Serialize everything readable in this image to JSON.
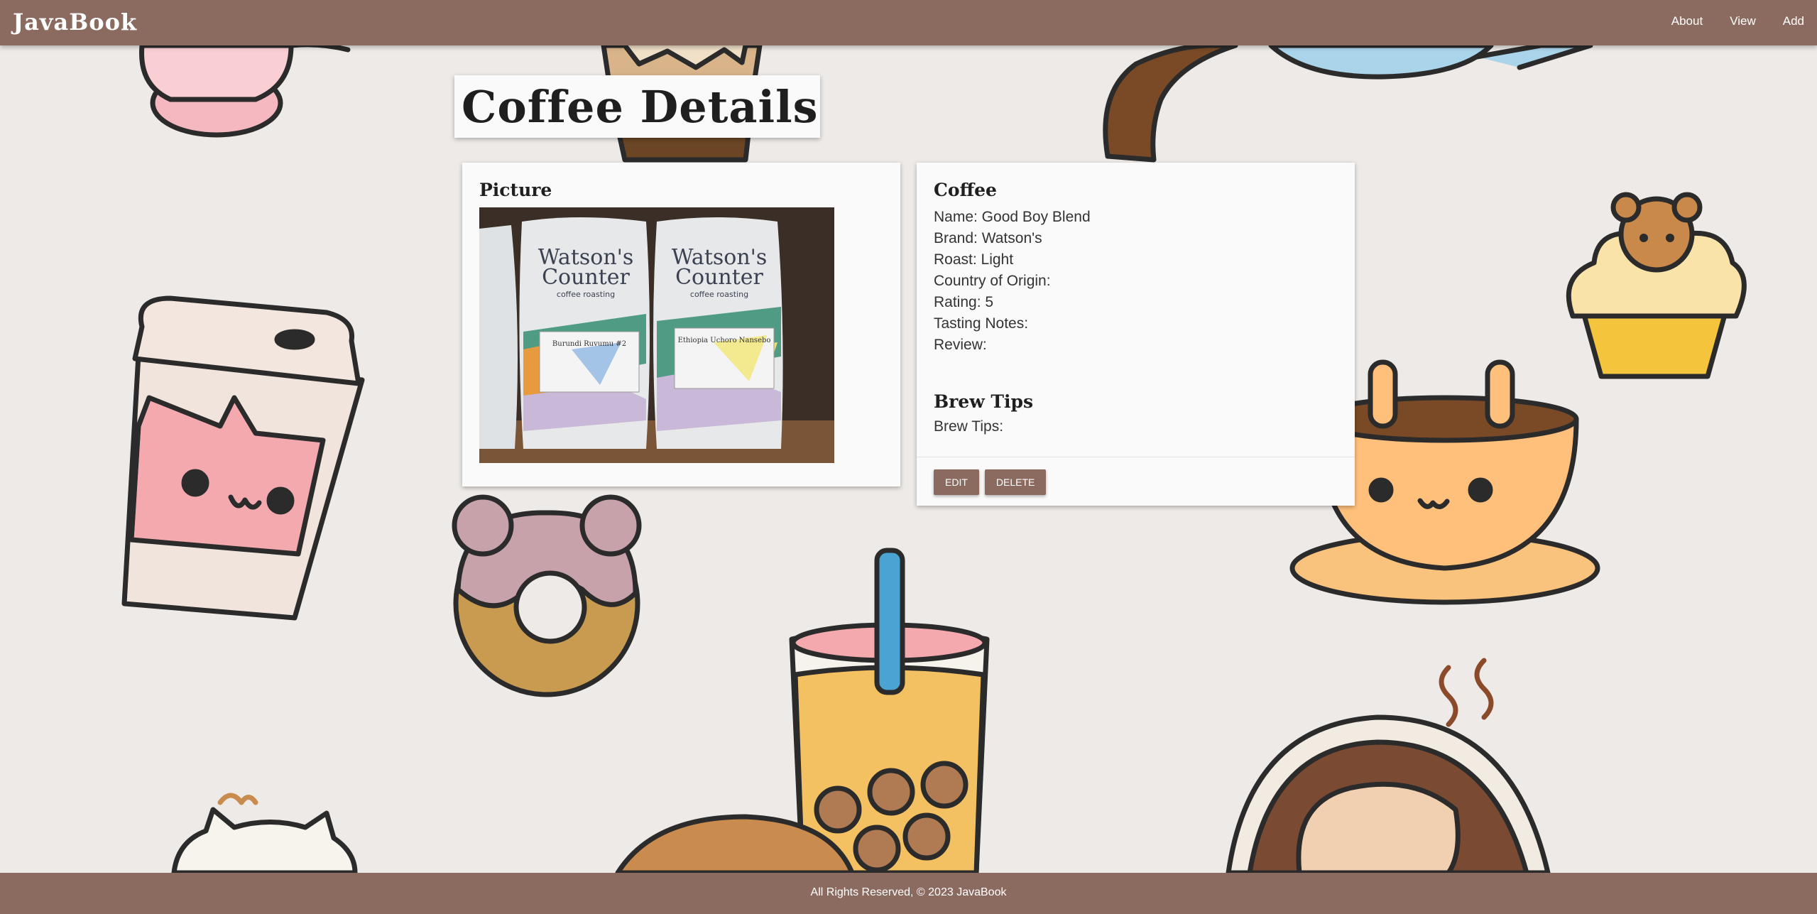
{
  "navbar": {
    "brand": "JavaBook",
    "links": [
      "About",
      "View",
      "Add"
    ]
  },
  "page": {
    "title": "Coffee Details"
  },
  "picture_card": {
    "title": "Picture",
    "photo": {
      "bag_brand_line1": "Watson's",
      "bag_brand_line2": "Counter",
      "bag_tagline": "coffee roasting",
      "label_left": "Burundi Ruvumu #2",
      "label_right": "Ethiopia Uchoro Nansebo"
    }
  },
  "coffee_card": {
    "title": "Coffee",
    "details": [
      "Name: Good Boy Blend",
      "Brand: Watson's",
      "Roast: Light",
      "Country of Origin:",
      "Rating: 5",
      "Tasting Notes:",
      "Review:"
    ],
    "brew_title": "Brew Tips",
    "brew_tips": "Brew Tips:",
    "buttons": {
      "edit": "EDIT",
      "delete": "DELETE"
    }
  },
  "footer": {
    "text": "All Rights Reserved, © 2023 JavaBook"
  },
  "colors": {
    "nav_brown": "#8b6b60",
    "background": "#eeeae7",
    "card": "#fafafa"
  }
}
